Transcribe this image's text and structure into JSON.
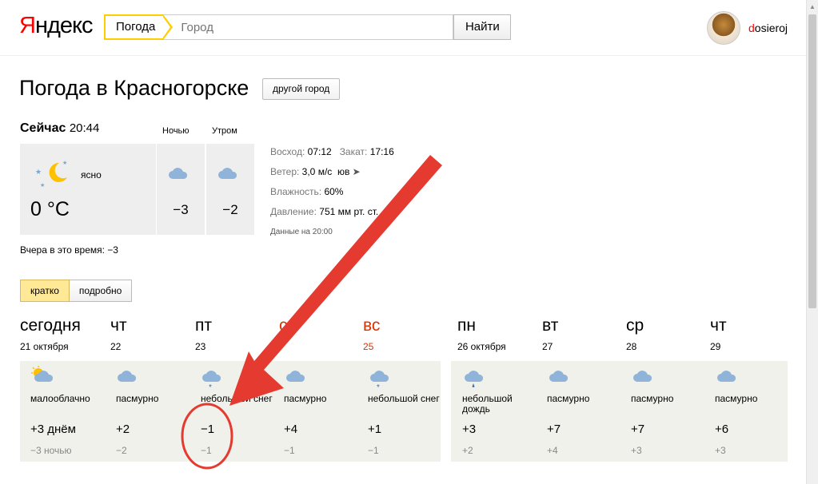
{
  "header": {
    "logo_y": "Я",
    "logo_rest": "ндекс",
    "search_tag": "Погода",
    "city_placeholder": "Город",
    "find_label": "Найти",
    "username_first": "d",
    "username_rest": "osieroj"
  },
  "title": {
    "text": "Погода в Красногорске",
    "other_city": "другой город"
  },
  "now": {
    "label": "Сейчас",
    "time": "20:44",
    "night_label": "Ночью",
    "morning_label": "Утром",
    "condition": "ясно",
    "temp": "0 °C",
    "night_temp": "−3",
    "morning_temp": "−2",
    "yesterday": "Вчера в это время: −3"
  },
  "info": {
    "sunrise_label": "Восход:",
    "sunrise": "07:12",
    "sunset_label": "Закат:",
    "sunset": "17:16",
    "wind_label": "Ветер:",
    "wind": "3,0 м/с",
    "wind_dir": "юв",
    "humidity_label": "Влажность:",
    "humidity": "60%",
    "pressure_label": "Давление:",
    "pressure": "751 мм рт. ст.",
    "data_at": "Данные на 20:00"
  },
  "tabs": {
    "brief": "кратко",
    "detail": "подробно"
  },
  "forecast": [
    {
      "day": "сегодня",
      "date": "21 октября",
      "condition": "малооблачно",
      "day_temp": "+3 днём",
      "night_temp": "−3 ночью",
      "icon": "partly-cloudy-icon",
      "weekend": false
    },
    {
      "day": "чт",
      "date": "22",
      "condition": "пасмурно",
      "day_temp": "+2",
      "night_temp": "−2",
      "icon": "cloud-icon",
      "weekend": false
    },
    {
      "day": "пт",
      "date": "23",
      "condition": "небольшой снег",
      "day_temp": "−1",
      "night_temp": "−1",
      "icon": "cloud-snow-icon",
      "weekend": false
    },
    {
      "day": "с",
      "date": "",
      "condition": "пасмурно",
      "day_temp": "+4",
      "night_temp": "−1",
      "icon": "cloud-icon",
      "weekend": true
    },
    {
      "day": "вс",
      "date": "25",
      "condition": "небольшой снег",
      "day_temp": "+1",
      "night_temp": "−1",
      "icon": "cloud-snow-icon",
      "weekend": true
    },
    {
      "day": "пн",
      "date": "26 октября",
      "condition": "небольшой дождь",
      "day_temp": "+3",
      "night_temp": "+2",
      "icon": "cloud-rain-icon",
      "weekend": false
    },
    {
      "day": "вт",
      "date": "27",
      "condition": "пасмурно",
      "day_temp": "+7",
      "night_temp": "+4",
      "icon": "cloud-icon",
      "weekend": false
    },
    {
      "day": "ср",
      "date": "28",
      "condition": "пасмурно",
      "day_temp": "+7",
      "night_temp": "+3",
      "icon": "cloud-icon",
      "weekend": false
    },
    {
      "day": "чт",
      "date": "29",
      "condition": "пасмурно",
      "day_temp": "+6",
      "night_temp": "+3",
      "icon": "cloud-icon",
      "weekend": false
    }
  ],
  "colors": {
    "accent": "#ffcc00",
    "weekend": "#e03000",
    "annotation": "#e53a2f",
    "cloud": "#8fb3d9"
  }
}
